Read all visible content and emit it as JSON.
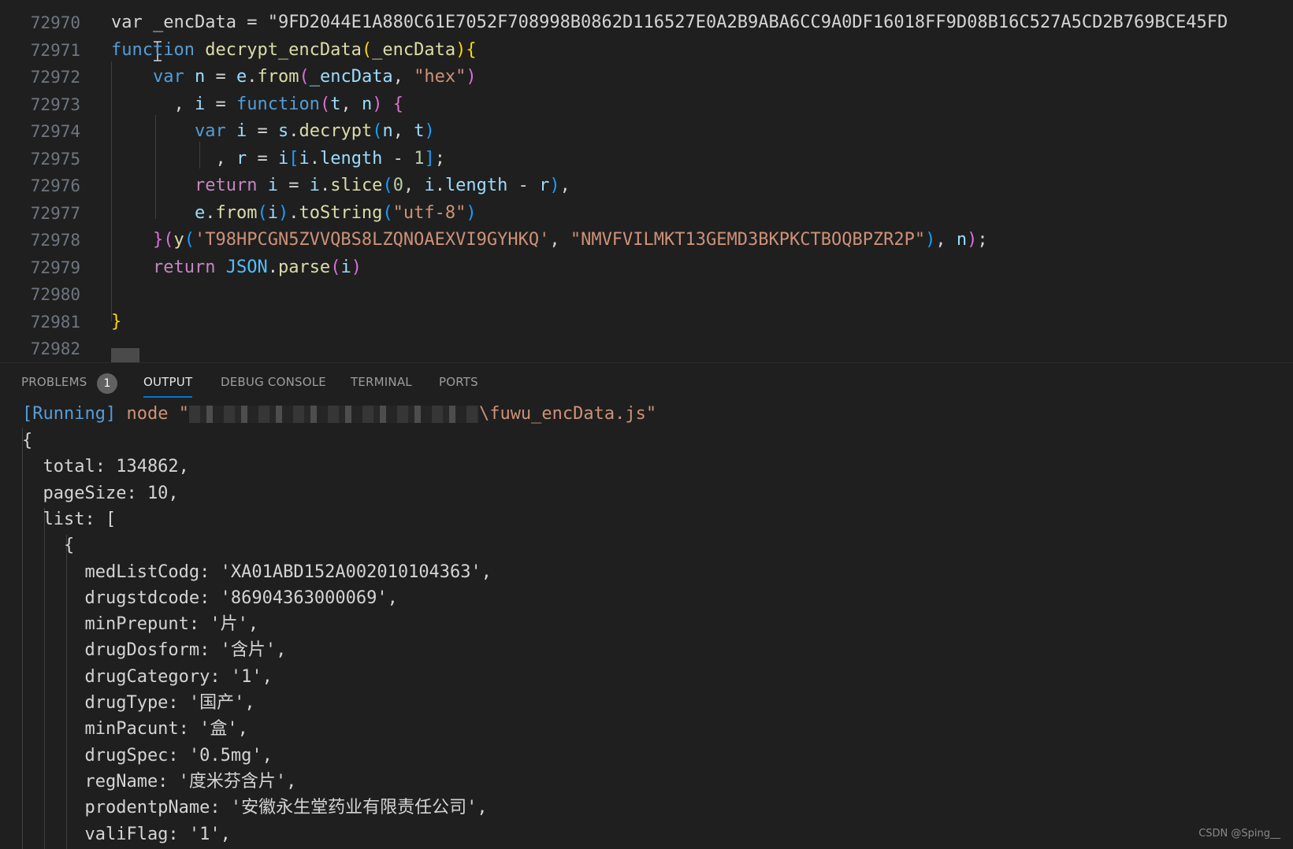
{
  "editor": {
    "lines": [
      {
        "num": "72970",
        "tokens": [
          {
            "t": "var ",
            "c": "pun"
          },
          {
            "t": "_encData",
            "c": "pun"
          },
          {
            "t": " = ",
            "c": "pun"
          },
          {
            "t": "\"9FD2044E1A880C61E7052F708998B0862D116527E0A2B9ABA6CC9A0DF16018FF9D08B16C527A5CD2B769BCE45FD",
            "c": "pun"
          }
        ]
      },
      {
        "num": "72971",
        "tokens": [
          {
            "t": "function",
            "c": "kw"
          },
          {
            "t": " ",
            "c": "pun"
          },
          {
            "t": "decrypt_encData",
            "c": "fn"
          },
          {
            "t": "(",
            "c": "b1"
          },
          {
            "t": "_encData",
            "c": "fn"
          },
          {
            "t": ")",
            "c": "b1"
          },
          {
            "t": "{",
            "c": "b1"
          }
        ]
      },
      {
        "num": "72972",
        "tokens": [
          {
            "t": "    ",
            "c": "pun"
          },
          {
            "t": "var",
            "c": "kw"
          },
          {
            "t": " ",
            "c": "pun"
          },
          {
            "t": "n",
            "c": "var"
          },
          {
            "t": " = ",
            "c": "pun"
          },
          {
            "t": "e",
            "c": "var"
          },
          {
            "t": ".",
            "c": "pun"
          },
          {
            "t": "from",
            "c": "fn"
          },
          {
            "t": "(",
            "c": "b2"
          },
          {
            "t": "_encData",
            "c": "var"
          },
          {
            "t": ", ",
            "c": "pun"
          },
          {
            "t": "\"hex\"",
            "c": "str"
          },
          {
            "t": ")",
            "c": "b2"
          }
        ]
      },
      {
        "num": "72973",
        "tokens": [
          {
            "t": "      , ",
            "c": "pun"
          },
          {
            "t": "i",
            "c": "var"
          },
          {
            "t": " = ",
            "c": "pun"
          },
          {
            "t": "function",
            "c": "kw"
          },
          {
            "t": "(",
            "c": "b2"
          },
          {
            "t": "t",
            "c": "var"
          },
          {
            "t": ", ",
            "c": "pun"
          },
          {
            "t": "n",
            "c": "var"
          },
          {
            "t": ")",
            "c": "b2"
          },
          {
            "t": " ",
            "c": "pun"
          },
          {
            "t": "{",
            "c": "b2"
          }
        ]
      },
      {
        "num": "72974",
        "tokens": [
          {
            "t": "        ",
            "c": "pun"
          },
          {
            "t": "var",
            "c": "kw"
          },
          {
            "t": " ",
            "c": "pun"
          },
          {
            "t": "i",
            "c": "var"
          },
          {
            "t": " = ",
            "c": "pun"
          },
          {
            "t": "s",
            "c": "var"
          },
          {
            "t": ".",
            "c": "pun"
          },
          {
            "t": "decrypt",
            "c": "fn"
          },
          {
            "t": "(",
            "c": "b3"
          },
          {
            "t": "n",
            "c": "var"
          },
          {
            "t": ", ",
            "c": "pun"
          },
          {
            "t": "t",
            "c": "var"
          },
          {
            "t": ")",
            "c": "b3"
          }
        ]
      },
      {
        "num": "72975",
        "tokens": [
          {
            "t": "          , ",
            "c": "pun"
          },
          {
            "t": "r",
            "c": "var"
          },
          {
            "t": " = ",
            "c": "pun"
          },
          {
            "t": "i",
            "c": "var"
          },
          {
            "t": "[",
            "c": "b3"
          },
          {
            "t": "i",
            "c": "var"
          },
          {
            "t": ".",
            "c": "pun"
          },
          {
            "t": "length",
            "c": "var"
          },
          {
            "t": " - ",
            "c": "pun"
          },
          {
            "t": "1",
            "c": "num"
          },
          {
            "t": "]",
            "c": "b3"
          },
          {
            "t": ";",
            "c": "pun"
          }
        ]
      },
      {
        "num": "72976",
        "tokens": [
          {
            "t": "        ",
            "c": "pun"
          },
          {
            "t": "return",
            "c": "kwc"
          },
          {
            "t": " ",
            "c": "pun"
          },
          {
            "t": "i",
            "c": "var"
          },
          {
            "t": " = ",
            "c": "pun"
          },
          {
            "t": "i",
            "c": "var"
          },
          {
            "t": ".",
            "c": "pun"
          },
          {
            "t": "slice",
            "c": "fn"
          },
          {
            "t": "(",
            "c": "b3"
          },
          {
            "t": "0",
            "c": "num"
          },
          {
            "t": ", ",
            "c": "pun"
          },
          {
            "t": "i",
            "c": "var"
          },
          {
            "t": ".",
            "c": "pun"
          },
          {
            "t": "length",
            "c": "var"
          },
          {
            "t": " - ",
            "c": "pun"
          },
          {
            "t": "r",
            "c": "var"
          },
          {
            "t": ")",
            "c": "b3"
          },
          {
            "t": ",",
            "c": "pun"
          }
        ]
      },
      {
        "num": "72977",
        "tokens": [
          {
            "t": "        ",
            "c": "pun"
          },
          {
            "t": "e",
            "c": "var"
          },
          {
            "t": ".",
            "c": "pun"
          },
          {
            "t": "from",
            "c": "fn"
          },
          {
            "t": "(",
            "c": "b3"
          },
          {
            "t": "i",
            "c": "var"
          },
          {
            "t": ")",
            "c": "b3"
          },
          {
            "t": ".",
            "c": "pun"
          },
          {
            "t": "toString",
            "c": "fn"
          },
          {
            "t": "(",
            "c": "b3"
          },
          {
            "t": "\"utf-8\"",
            "c": "str"
          },
          {
            "t": ")",
            "c": "b3"
          }
        ]
      },
      {
        "num": "72978",
        "tokens": [
          {
            "t": "    ",
            "c": "pun"
          },
          {
            "t": "}",
            "c": "b2"
          },
          {
            "t": "(",
            "c": "b2"
          },
          {
            "t": "y",
            "c": "fn"
          },
          {
            "t": "(",
            "c": "b3"
          },
          {
            "t": "'T98HPCGN5ZVVQBS8LZQNOAEXVI9GYHKQ'",
            "c": "str"
          },
          {
            "t": ", ",
            "c": "pun"
          },
          {
            "t": "\"NMVFVILMKT13GEMD3BKPKCTBOQBPZR2P\"",
            "c": "str"
          },
          {
            "t": ")",
            "c": "b3"
          },
          {
            "t": ", ",
            "c": "pun"
          },
          {
            "t": "n",
            "c": "var"
          },
          {
            "t": ")",
            "c": "b2"
          },
          {
            "t": ";",
            "c": "pun"
          }
        ]
      },
      {
        "num": "72979",
        "tokens": [
          {
            "t": "    ",
            "c": "pun"
          },
          {
            "t": "return",
            "c": "kwc"
          },
          {
            "t": " ",
            "c": "pun"
          },
          {
            "t": "JSON",
            "c": "obj"
          },
          {
            "t": ".",
            "c": "pun"
          },
          {
            "t": "parse",
            "c": "fn"
          },
          {
            "t": "(",
            "c": "b2"
          },
          {
            "t": "i",
            "c": "var"
          },
          {
            "t": ")",
            "c": "b2"
          }
        ]
      },
      {
        "num": "72980",
        "tokens": []
      },
      {
        "num": "72981",
        "tokens": [
          {
            "t": "}",
            "c": "b1"
          }
        ]
      },
      {
        "num": "72982",
        "tokens": []
      }
    ]
  },
  "panel": {
    "tabs": [
      {
        "label": "PROBLEMS",
        "active": false
      },
      {
        "label": "OUTPUT",
        "active": true
      },
      {
        "label": "DEBUG CONSOLE",
        "active": false
      },
      {
        "label": "TERMINAL",
        "active": false
      },
      {
        "label": "PORTS",
        "active": false
      }
    ],
    "problems_count": "1"
  },
  "output": {
    "running_tag": "[Running]",
    "command": "node",
    "path_open": "\"",
    "path_tail": "\\fuwu_encData.js\"",
    "lines": [
      "{",
      "  total: 134862,",
      "  pageSize: 10,",
      "  list: [",
      "    {",
      "      medListCodg: 'XA01ABD152A002010104363',",
      "      drugstdcode: '86904363000069',",
      "      minPrepunt: '片',",
      "      drugDosform: '含片',",
      "      drugCategory: '1',",
      "      drugType: '国产',",
      "      minPacunt: '盒',",
      "      drugSpec: '0.5mg',",
      "      regName: '度米芬含片',",
      "      prodentpName: '安徽永生堂药业有限责任公司',",
      "      valiFlag: '1',"
    ]
  },
  "watermark": "CSDN @Sping__"
}
